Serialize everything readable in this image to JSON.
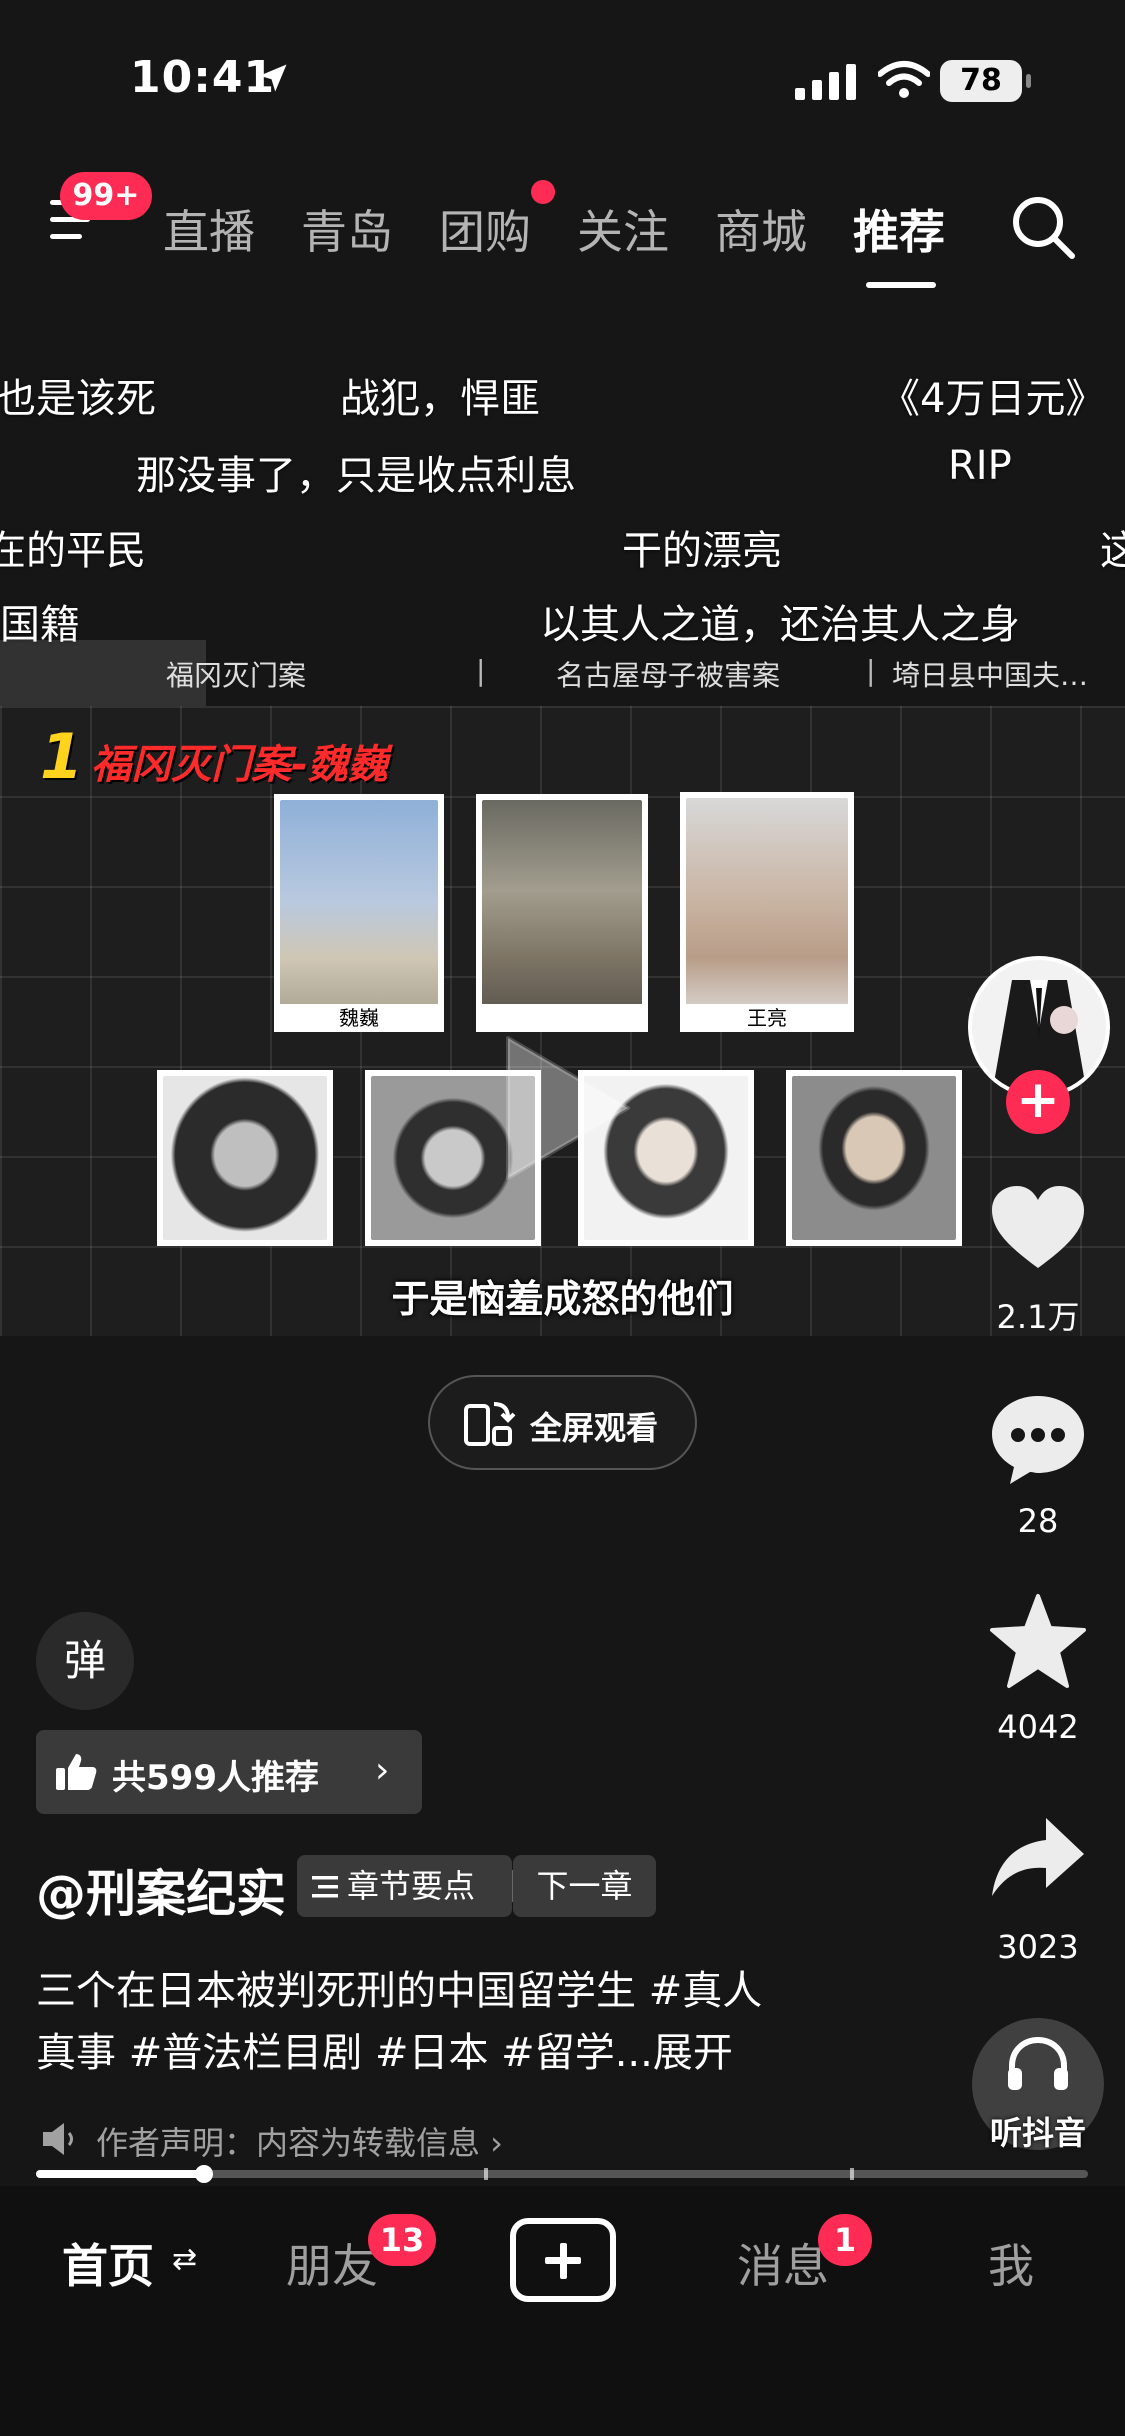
{
  "status_bar": {
    "time": "10:41",
    "battery": "78"
  },
  "nav": {
    "menu_badge": "99+",
    "tabs": [
      {
        "label": "直播"
      },
      {
        "label": "青岛"
      },
      {
        "label": "团购"
      },
      {
        "label": "关注"
      },
      {
        "label": "商城"
      },
      {
        "label": "推荐"
      }
    ]
  },
  "danmaku": [
    "也是该死",
    "战犯，悍匪",
    "《4万日元》",
    "那没事了，只是收点利息",
    "RIP",
    "在的平民",
    "干的漂亮",
    "这",
    "国籍",
    "以其人之道，还治其人之身"
  ],
  "chapters": [
    "福冈灭门案",
    "名古屋母子被害案",
    "埼日县中国夫…"
  ],
  "video": {
    "title_number": "1",
    "title_text": "福冈灭门案-魏巍",
    "photo_captions": [
      "魏巍",
      "",
      "王亮"
    ],
    "subtitle": "于是恼羞成怒的他们"
  },
  "fullscreen_label": "全屏观看",
  "rail": {
    "likes": "2.1万",
    "comments": "28",
    "favorites": "4042",
    "shares": "3023",
    "listen_label": "听抖音"
  },
  "danmaku_button": "弹",
  "recommend": "共599人推荐",
  "author": "@刑案纪实",
  "chapter_chips": {
    "list": "章节要点",
    "next": "下一章"
  },
  "description": {
    "line1": "三个在日本被判死刑的中国留学生 #真人",
    "line2": "真事 #普法栏目剧 #日本 #留学...展开"
  },
  "declaration": "作者声明：内容为转载信息 ›",
  "progress": {
    "played_fraction": 0.16
  },
  "tabbar": {
    "home": "首页",
    "home_swap": "⇄",
    "friends": "朋友",
    "friends_badge": "13",
    "messages": "消息",
    "messages_badge": "1",
    "me": "我"
  },
  "colors": {
    "accent": "#fe2c55",
    "background": "#161616",
    "title_red": "#ff2b2b",
    "title_yellow": "#ffd21e"
  }
}
